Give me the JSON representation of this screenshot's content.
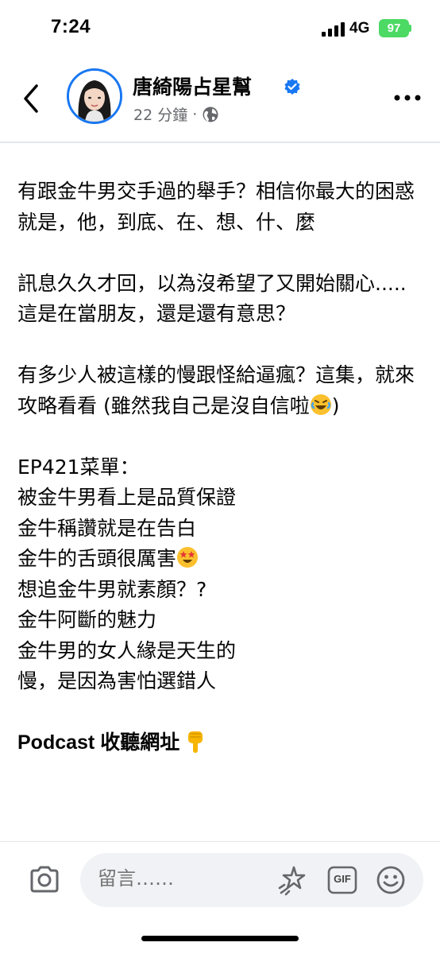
{
  "status_bar": {
    "time": "7:24",
    "network": "4G",
    "battery": "97"
  },
  "header": {
    "page_name": "唐綺陽占星幫",
    "time_ago": "22 分鐘",
    "separator": "·",
    "icons": [
      "back-icon",
      "verified-icon",
      "globe-icon",
      "more-icon"
    ]
  },
  "post": {
    "paragraph_1": "有跟金牛男交手過的舉手？相信你最大的困惑就是，他，到底、在、想、什、麼",
    "paragraph_2": "訊息久久才回，以為沒希望了又開始關心.....這是在當朋友，還是還有意思？",
    "paragraph_3": "有多少人被這樣的慢跟怪給逼瘋？這集，就來攻略看看 (雖然我自己是沒自信啦",
    "paragraph_3_end": ")",
    "menu_title": "EP421菜單：",
    "menu_items": [
      "被金牛男看上是品質保證",
      "金牛稱讚就是在告白",
      "金牛的舌頭很厲害",
      "想追金牛男就素顏？?",
      "金牛阿斷的魅力",
      "金牛男的女人緣是天生的",
      "慢，是因為害怕選錯人"
    ],
    "podcast_label": "Podcast 收聽網址",
    "emojis": [
      "rolling-laughing-emoji",
      "star-struck-emoji",
      "pointing-down-emoji"
    ]
  },
  "comment_bar": {
    "placeholder": "留言……",
    "gif_label": "GIF",
    "icons": [
      "camera-icon",
      "sticker-icon",
      "gif-icon",
      "emoji-icon"
    ]
  },
  "colors": {
    "accent": "#1877f2",
    "battery": "#4cd964",
    "muted_text": "#65676b",
    "input_bg": "#f0f2f5"
  }
}
